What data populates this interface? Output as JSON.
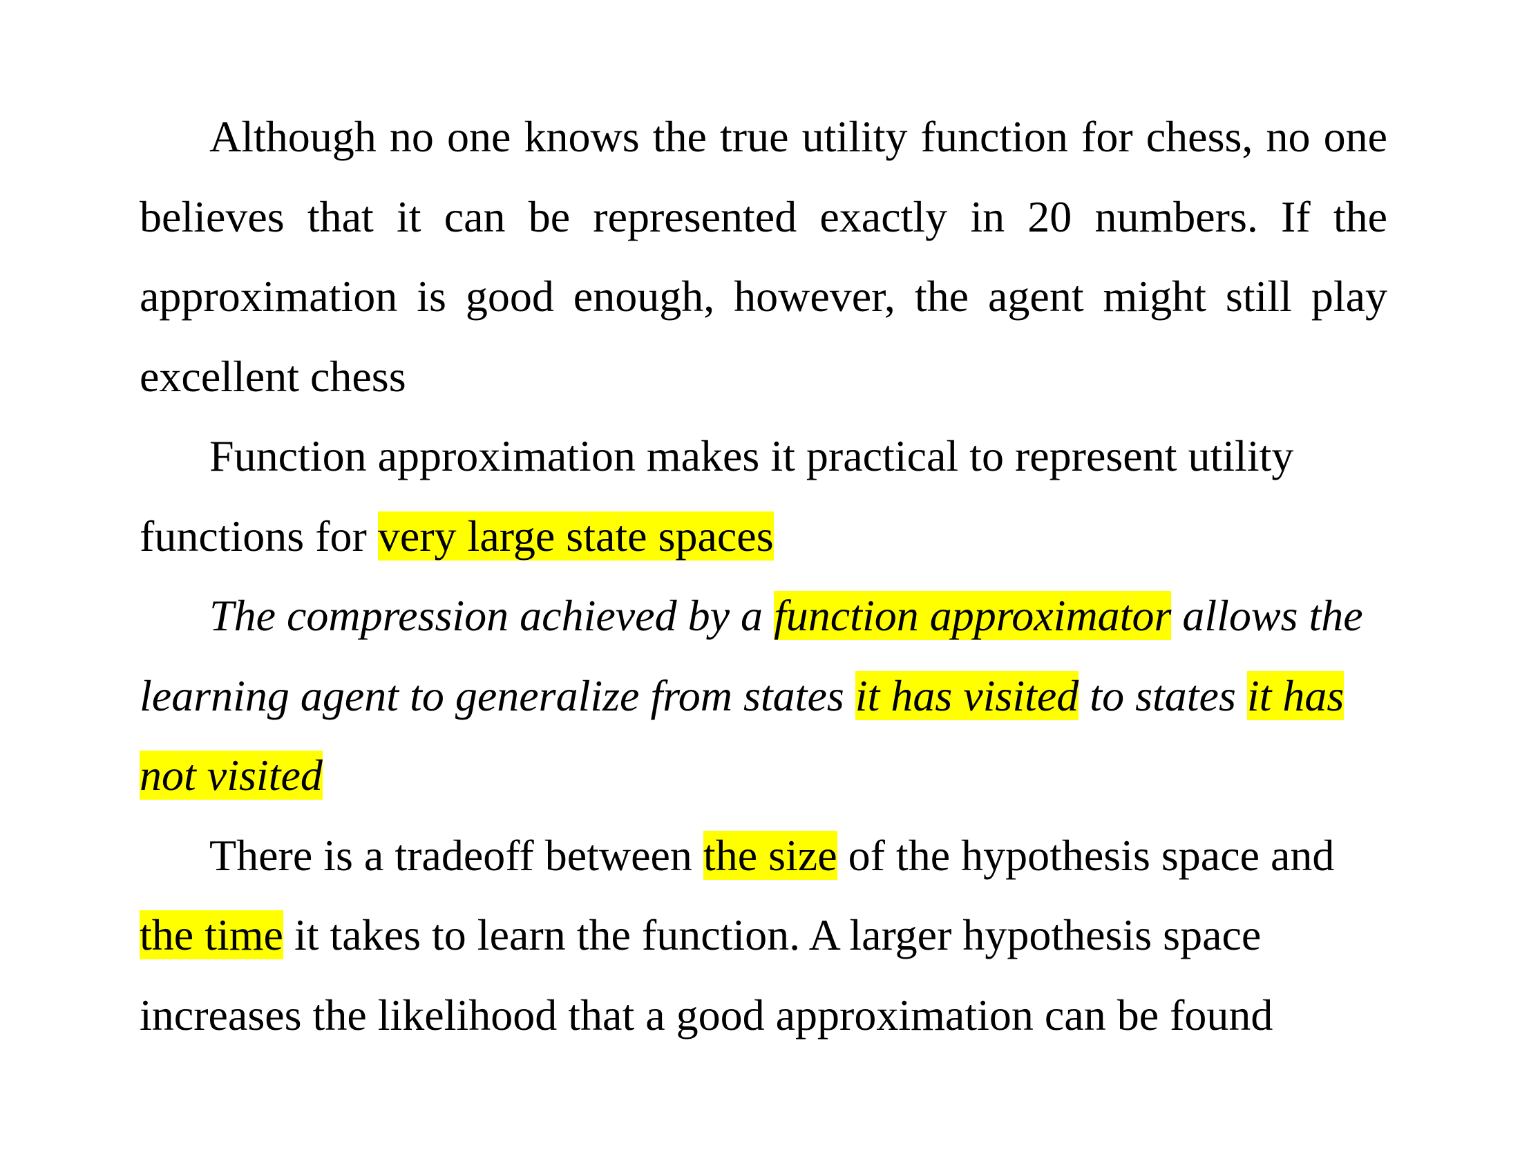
{
  "highlight_color": "#ffff00",
  "paragraphs": [
    {
      "id": "p1",
      "style": "normal",
      "align": "justify",
      "segments": [
        {
          "text": "Although no one knows the true utility function for chess, no one believes that it can be represented exactly in 20 numbers. If the approximation is good enough, however, the agent might still play excellent chess",
          "highlight": false
        }
      ]
    },
    {
      "id": "p2",
      "style": "normal",
      "align": "left",
      "segments": [
        {
          "text": "Function approximation makes it practical to represent utility functions for ",
          "highlight": false
        },
        {
          "text": "very large state spaces",
          "highlight": true
        }
      ]
    },
    {
      "id": "p3",
      "style": "italic",
      "align": "left",
      "segments": [
        {
          "text": "The compression achieved by a ",
          "highlight": false
        },
        {
          "text": "function approximator",
          "highlight": true
        },
        {
          "text": " allows the learning agent to generalize from states ",
          "highlight": false
        },
        {
          "text": "it has visited",
          "highlight": true
        },
        {
          "text": " to states ",
          "highlight": false
        },
        {
          "text": "it has not visited",
          "highlight": true
        }
      ]
    },
    {
      "id": "p4",
      "style": "normal",
      "align": "left",
      "segments": [
        {
          "text": "There is a tradeoff between ",
          "highlight": false
        },
        {
          "text": "the size",
          "highlight": true
        },
        {
          "text": " of the hypothesis space and ",
          "highlight": false
        },
        {
          "text": "the time",
          "highlight": true
        },
        {
          "text": " it takes to learn the function. A larger hypothesis space increases the likelihood that a good approximation can be found",
          "highlight": false
        }
      ]
    }
  ]
}
